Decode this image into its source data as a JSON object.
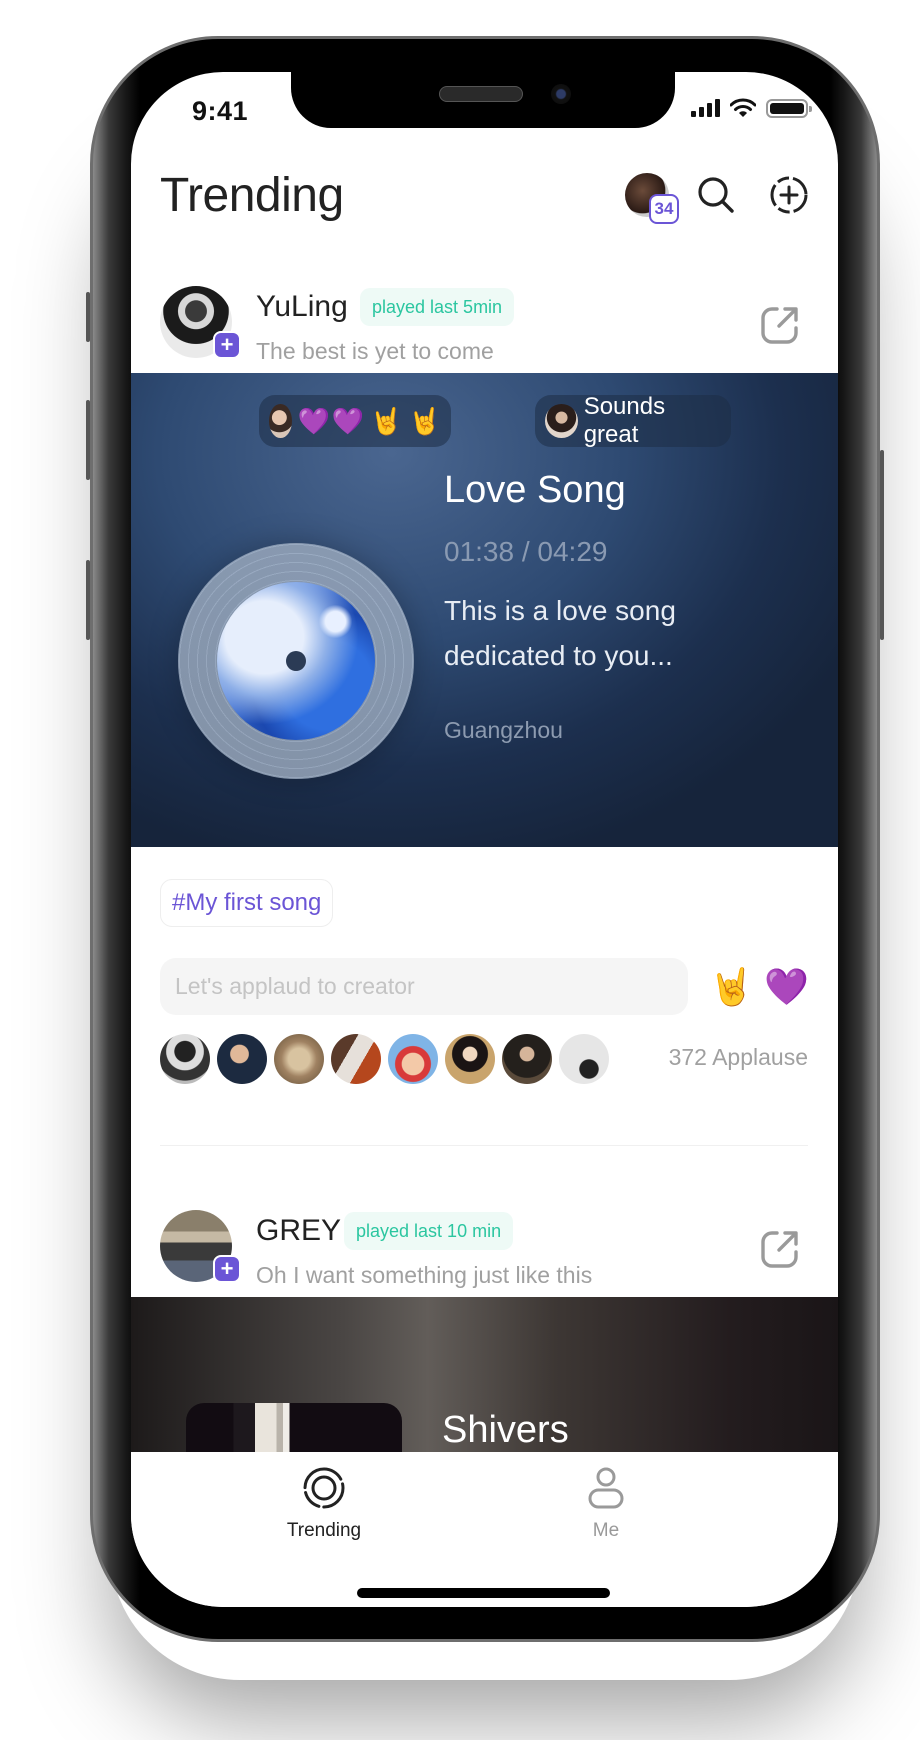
{
  "status_bar": {
    "time": "9:41"
  },
  "header": {
    "title": "Trending",
    "notification_count": "34"
  },
  "posts": [
    {
      "user": "YuLing",
      "played_badge": "played last 5min",
      "status": "The best is yet to come",
      "reactions": [
        "💜",
        "💜",
        "🤘",
        "🤘"
      ],
      "comment_bubble": "Sounds great",
      "song_title": "Love Song",
      "progress": "01:38 / 04:29",
      "description": "This is a love song dedicated to you...",
      "location": "Guangzhou",
      "hashtag": "#My first song",
      "applaud_placeholder": "Let's applaud to creator",
      "quick_emojis": [
        "🤘",
        "💜"
      ],
      "applause_count": "372 Applause",
      "fan_avatar_count": 8
    },
    {
      "user": "GREY",
      "played_badge": "played last 10 min",
      "status": "Oh I want something just like this",
      "song_title": "Shivers"
    }
  ],
  "tab_bar": {
    "tabs": [
      {
        "label": "Trending",
        "icon": "trending-ring-icon",
        "active": true
      },
      {
        "label": "Me",
        "icon": "person-icon",
        "active": false
      }
    ]
  },
  "colors": {
    "accent": "#6b55d6",
    "badge_text": "#2bc6a0",
    "badge_bg": "#eefaf6",
    "muted_text": "#a0a0a0"
  }
}
